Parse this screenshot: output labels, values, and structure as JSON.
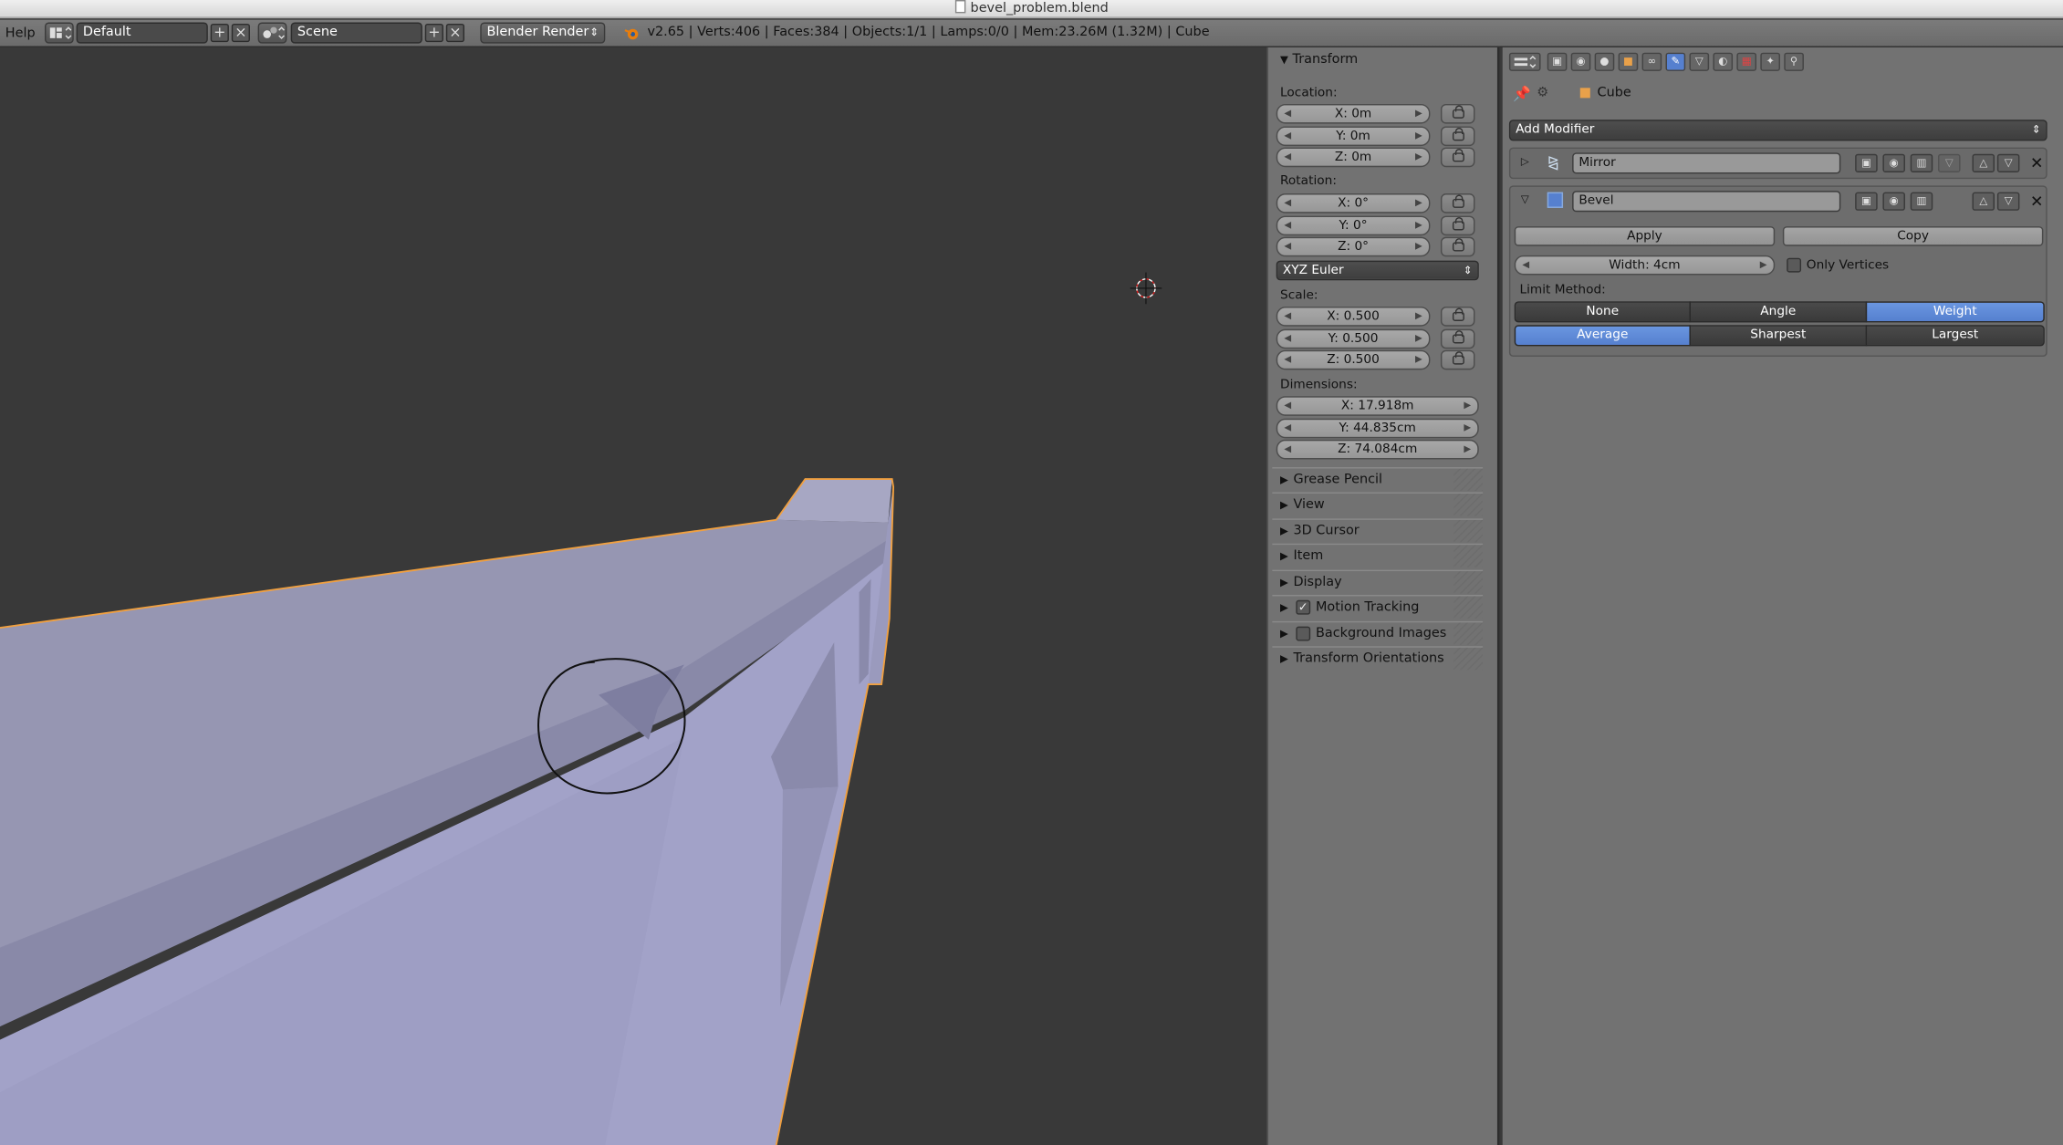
{
  "window": {
    "title": "bevel_problem.blend"
  },
  "header": {
    "menu_help": "Help",
    "screen_layout": "Default",
    "scene": "Scene",
    "render_engine": "Blender Render",
    "info": "v2.65 | Verts:406 | Faces:384 | Objects:1/1 | Lamps:0/0 | Mem:23.26M (1.32M) | Cube"
  },
  "npanel": {
    "transform_title": "Transform",
    "location_label": "Location:",
    "location": {
      "x": "X: 0m",
      "y": "Y: 0m",
      "z": "Z: 0m"
    },
    "rotation_label": "Rotation:",
    "rotation": {
      "x": "X: 0°",
      "y": "Y: 0°",
      "z": "Z: 0°"
    },
    "rotation_mode": "XYZ Euler",
    "scale_label": "Scale:",
    "scale": {
      "x": "X: 0.500",
      "y": "Y: 0.500",
      "z": "Z: 0.500"
    },
    "dimensions_label": "Dimensions:",
    "dimensions": {
      "x": "X: 17.918m",
      "y": "Y: 44.835cm",
      "z": "Z: 74.084cm"
    },
    "sections": [
      "Grease Pencil",
      "View",
      "3D Cursor",
      "Item",
      "Display",
      "Motion Tracking",
      "Background Images",
      "Transform Orientations"
    ],
    "motion_tracking_checked": true,
    "background_images_checked": false
  },
  "properties": {
    "context_object": "Cube",
    "add_modifier": "Add Modifier",
    "modifiers": [
      {
        "name": "Mirror",
        "expanded": false
      },
      {
        "name": "Bevel",
        "expanded": true
      }
    ],
    "apply_label": "Apply",
    "copy_label": "Copy",
    "width_field": "Width: 4cm",
    "only_vertices_label": "Only Vertices",
    "only_vertices_checked": false,
    "limit_method_label": "Limit Method:",
    "limit_methods": [
      "None",
      "Angle",
      "Weight"
    ],
    "limit_method_selected": "Weight",
    "edge_weight_methods": [
      "Average",
      "Sharpest",
      "Largest"
    ],
    "edge_weight_selected": "Average"
  },
  "colors": {
    "viewport_bg": "#393939",
    "mesh": "#a2a2c8",
    "selection_outline": "#f0a040",
    "accent": "#5680cf"
  }
}
